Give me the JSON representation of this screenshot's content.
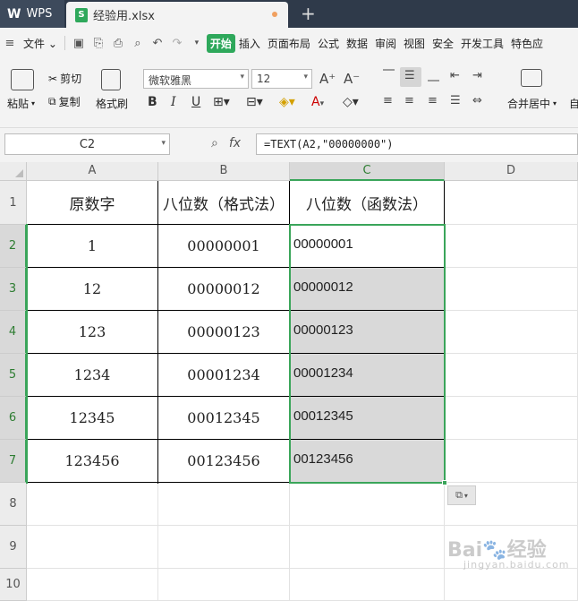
{
  "titlebar": {
    "app_name": "WPS",
    "file_tab": "经验用.xlsx",
    "new_tab_symbol": "+"
  },
  "menubar": {
    "file": "文件",
    "items": [
      "开始",
      "插入",
      "页面布局",
      "公式",
      "数据",
      "审阅",
      "视图",
      "安全",
      "开发工具",
      "特色应"
    ],
    "active": "开始"
  },
  "toolbar": {
    "paste": "粘贴",
    "cut": "剪切",
    "copy": "复制",
    "format_painter": "格式刷",
    "font_name": "微软雅黑",
    "font_size": "12",
    "merge_center": "合并居中",
    "auto": "自"
  },
  "formula_bar": {
    "cell_ref": "C2",
    "fx": "fx",
    "formula": "=TEXT(A2,\"00000000\")"
  },
  "grid": {
    "columns": [
      "A",
      "B",
      "C",
      "D"
    ],
    "rows": [
      "1",
      "2",
      "3",
      "4",
      "5",
      "6",
      "7",
      "8",
      "9",
      "10"
    ],
    "header_row": [
      "原数字",
      "八位数（格式法）",
      "八位数（函数法）"
    ],
    "data": [
      [
        "1",
        "00000001",
        "00000001"
      ],
      [
        "12",
        "00000012",
        "00000012"
      ],
      [
        "123",
        "00000123",
        "00000123"
      ],
      [
        "1234",
        "00001234",
        "00001234"
      ],
      [
        "12345",
        "00012345",
        "00012345"
      ],
      [
        "123456",
        "00123456",
        "00123456"
      ]
    ]
  },
  "colors": {
    "accent": "#2ea85b",
    "selection_fill": "#d9d9d9",
    "titlebar": "#2f3a4a"
  }
}
